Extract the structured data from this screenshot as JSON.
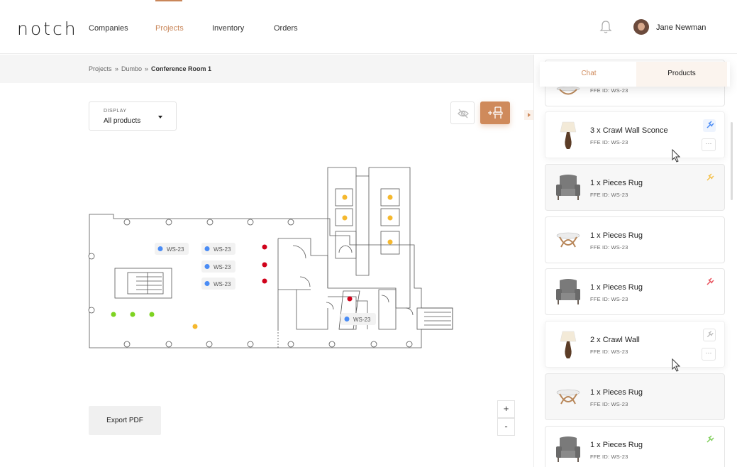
{
  "header": {
    "logo": "notch",
    "nav": [
      {
        "label": "Companies",
        "active": false
      },
      {
        "label": "Projects",
        "active": true
      },
      {
        "label": "Inventory",
        "active": false
      },
      {
        "label": "Orders",
        "active": false
      }
    ],
    "notifications_icon": "bell-icon",
    "user_name": "Jane Newman"
  },
  "breadcrumb": [
    "Projects",
    "Dumbo",
    "Conference Room 1"
  ],
  "breadcrumb_separator": "»",
  "display_select": {
    "label": "DISPLAY",
    "value": "All products"
  },
  "toolbar": {
    "hide_icon": "eye-slash-icon",
    "add_icon": "add-chair-icon"
  },
  "floorplan": {
    "markers": [
      {
        "label": "WS-23",
        "color": "blue"
      },
      {
        "label": "WS-23",
        "color": "blue"
      },
      {
        "label": "WS-23",
        "color": "blue"
      },
      {
        "label": "WS-23",
        "color": "blue"
      },
      {
        "label": "WS-23",
        "color": "blue"
      }
    ]
  },
  "export_label": "Export PDF",
  "zoom": {
    "in": "+",
    "out": "-"
  },
  "panel": {
    "tabs": [
      {
        "label": "Chat",
        "active": false
      },
      {
        "label": "Products",
        "active": true
      }
    ],
    "items": [
      {
        "title": "",
        "ffe": "FFE ID: WS-23",
        "image": "round-table"
      },
      {
        "title": "3 x Crawl Wall Sconce",
        "ffe": "FFE ID: WS-23",
        "image": "lamp",
        "pin_color": "#4a8cf5"
      },
      {
        "title": "1 x Pieces Rug",
        "ffe": "FFE ID: WS-23",
        "image": "armchair",
        "pin_color": "#f4c04a"
      },
      {
        "title": "1 x Pieces Rug",
        "ffe": "FFE ID: WS-23",
        "image": "round-table"
      },
      {
        "title": "1 x Pieces Rug",
        "ffe": "FFE ID: WS-23",
        "image": "armchair",
        "pin_color": "#e8505b"
      },
      {
        "title": "2 x Crawl Wall",
        "ffe": "FFE ID: WS-23",
        "image": "lamp",
        "pin_color": "#bbbbbb"
      },
      {
        "title": "1 x Pieces Rug",
        "ffe": "FFE ID: WS-23",
        "image": "round-table"
      },
      {
        "title": "1 x Pieces Rug",
        "ffe": "FFE ID: WS-23",
        "image": "armchair",
        "pin_color": "#7fcf5a"
      }
    ]
  },
  "colors": {
    "accent": "#cf8a5b",
    "blue": "#4a8cf5",
    "red": "#d0021b",
    "yellow": "#f5b82e",
    "green": "#7ed321"
  }
}
